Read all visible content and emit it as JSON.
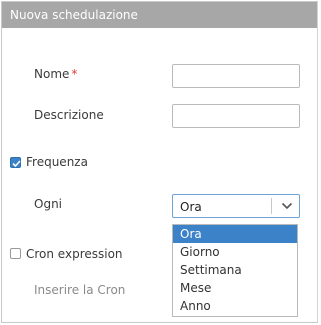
{
  "dialog": {
    "title": "Nuova schedulazione"
  },
  "fields": {
    "nome_label": "Nome",
    "nome_required": "*",
    "nome_value": "",
    "descrizione_label": "Descrizione",
    "descrizione_value": "",
    "frequenza_label": "Frequenza",
    "frequenza_checked": true,
    "ogni_label": "Ogni",
    "cron_label": "Cron expression",
    "cron_checked": false,
    "cron_input_label": "Inserire la Cron"
  },
  "select": {
    "value": "Ora",
    "options": [
      "Ora",
      "Giorno",
      "Settimana",
      "Mese",
      "Anno"
    ],
    "selected_index": 0
  },
  "colors": {
    "accent": "#3b82c8",
    "title_bar": "#a7a7a7",
    "required": "#e03a3a"
  }
}
